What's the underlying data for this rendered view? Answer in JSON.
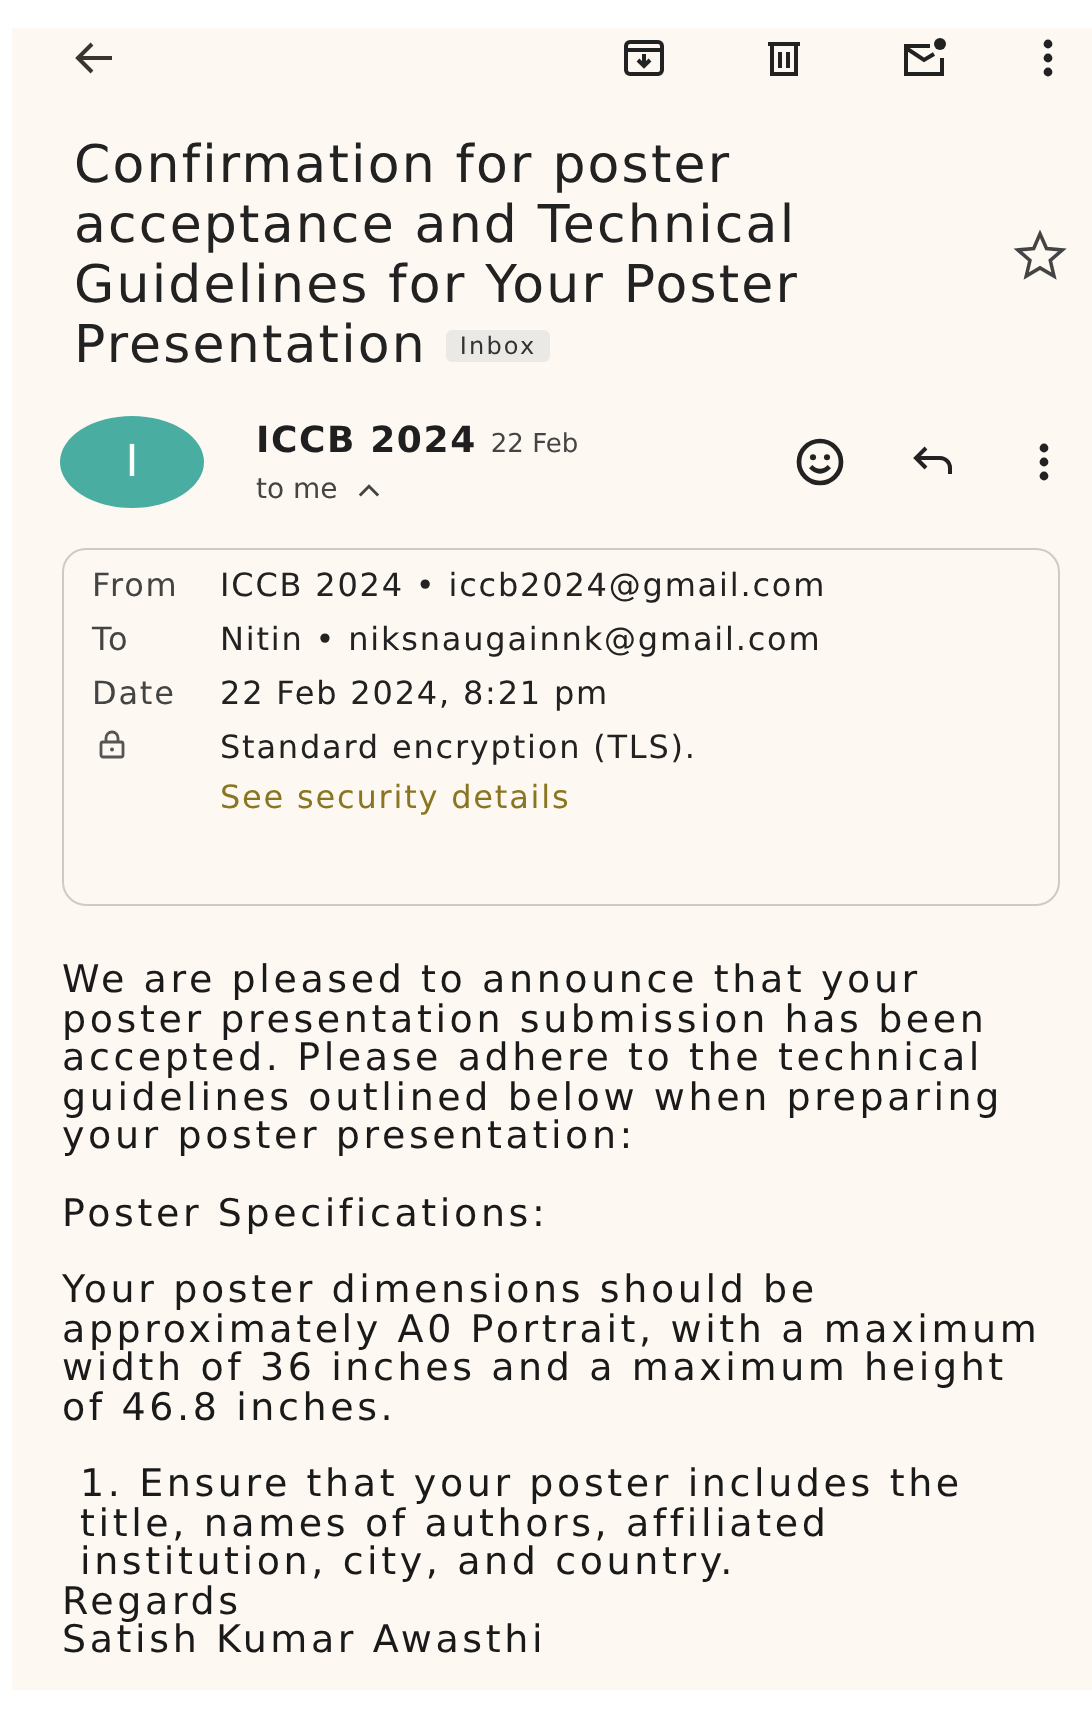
{
  "subject": {
    "title": "Confirmation for poster acceptance and Technical Guidelines for Your Poster Presentation",
    "label": "Inbox",
    "starred": false
  },
  "sender": {
    "initial": "I",
    "color": "#4aada1",
    "name": "ICCB 2024",
    "date": "22 Feb",
    "recipient": "to me",
    "expanded": true
  },
  "details": [
    {
      "kind": "text",
      "label": "From",
      "value": "ICCB 2024 • iccb2024@gmail.com"
    },
    {
      "kind": "text",
      "label": "To",
      "value": "Nitin • niksnaugainnk@gmail.com"
    },
    {
      "kind": "text",
      "label": "Date",
      "value": "22 Feb 2024, 8:21 pm"
    },
    {
      "kind": "security",
      "value": "Standard encryption (TLS).",
      "link": "See security details"
    }
  ],
  "body": [
    {
      "kind": "para",
      "lines": [
        "We are pleased to announce that your",
        "poster presentation submission has been",
        "accepted. Please adhere to the technical",
        "guidelines outlined below when preparing",
        "your poster presentation:"
      ]
    },
    {
      "kind": "para",
      "lines": [
        "Poster Specifications:"
      ]
    },
    {
      "kind": "para",
      "lines": [
        "Your poster dimensions should be",
        "approximately A0 Portrait, with a maximum",
        "width of 36 inches and a maximum height",
        "of 46.8 inches."
      ]
    },
    {
      "kind": "item",
      "lines": [
        "1. Ensure that your poster includes the",
        "title, names of authors, affiliated",
        "institution, city, and country."
      ]
    },
    {
      "kind": "line",
      "lines": [
        "Regards"
      ]
    },
    {
      "kind": "line",
      "lines": [
        "Satish Kumar Awasthi"
      ]
    }
  ]
}
